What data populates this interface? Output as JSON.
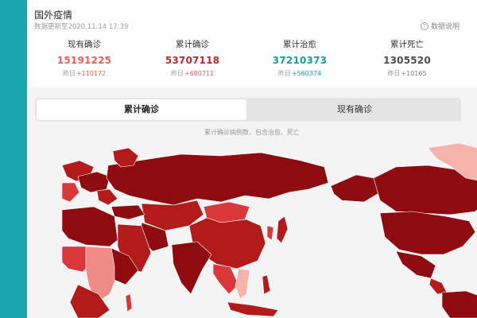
{
  "header": {
    "title": "国外疫情",
    "updated": "数据更新至2020.11.14 17:39",
    "help_label": "数据说明"
  },
  "stats": [
    {
      "label": "现有确诊",
      "value": "15191225",
      "delta_prefix": "昨日",
      "delta": "+110172",
      "color": "#e75e58",
      "delta_color": "#e75e58"
    },
    {
      "label": "累计确诊",
      "value": "53707118",
      "delta_prefix": "昨日",
      "delta": "+680711",
      "color": "#b9292c",
      "delta_color": "#e75e58"
    },
    {
      "label": "累计治愈",
      "value": "37210373",
      "delta_prefix": "昨日",
      "delta": "+560374",
      "color": "#179e9b",
      "delta_color": "#179e9b"
    },
    {
      "label": "累计死亡",
      "value": "1305520",
      "delta_prefix": "昨日",
      "delta": "+10165",
      "color": "#4b4b4b",
      "delta_color": "#7a7a7a"
    }
  ],
  "tabs": [
    {
      "label": "累计确诊",
      "active": true
    },
    {
      "label": "现有确诊",
      "active": false
    }
  ],
  "map": {
    "note": "累计确诊病例数，包含治愈、死亡",
    "colors": {
      "dark": "#8e0b0f",
      "mid": "#b31b1b",
      "light": "#d9383a",
      "pale": "#f08a86",
      "lightest": "#f6b3ac",
      "border": "#ffffff"
    }
  }
}
